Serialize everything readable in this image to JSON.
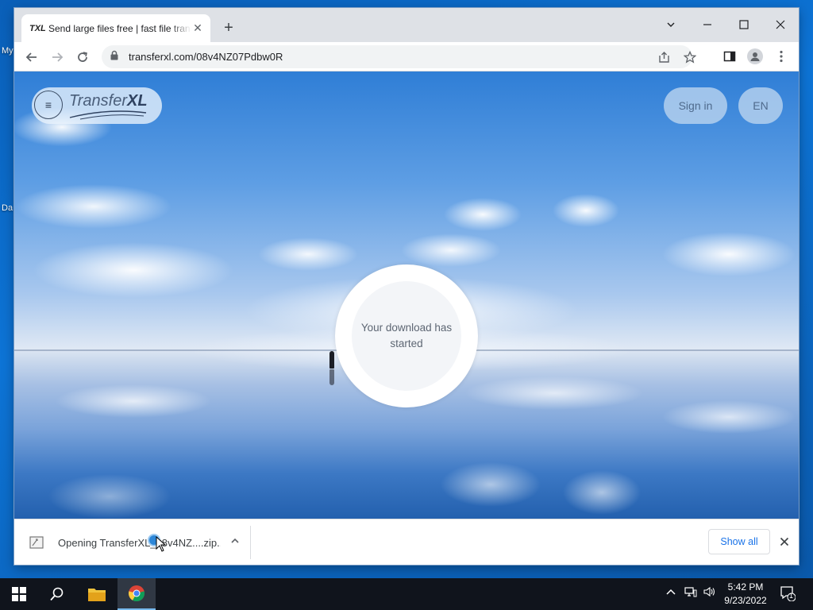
{
  "desktop": {
    "icon_labels": [
      "My",
      "Da"
    ]
  },
  "browser": {
    "tab": {
      "favicon_text": "TXL",
      "title": "Send large files free | fast file transfer"
    },
    "url": "transferxl.com/08v4NZ07Pdbw0R"
  },
  "page": {
    "logo": {
      "prefix": "Transfer",
      "suffix": "XL"
    },
    "sign_in_label": "Sign in",
    "language_label": "EN",
    "status_text": "Your download has started"
  },
  "download_shelf": {
    "item_text": "Opening TransferXL_08v4NZ....zip...",
    "show_all_label": "Show all"
  },
  "taskbar": {
    "time": "5:42 PM",
    "date": "9/23/2022",
    "notification_count": "1"
  },
  "colors": {
    "accent": "#1a73e8",
    "taskbar": "#10141c",
    "desktop": "#0d74d6"
  },
  "icons": [
    "start-icon",
    "search-icon",
    "file-explorer-icon",
    "chrome-icon",
    "back-icon",
    "forward-icon",
    "reload-icon",
    "lock-icon",
    "share-icon",
    "star-icon",
    "side-panel-icon",
    "profile-icon",
    "more-icon"
  ]
}
